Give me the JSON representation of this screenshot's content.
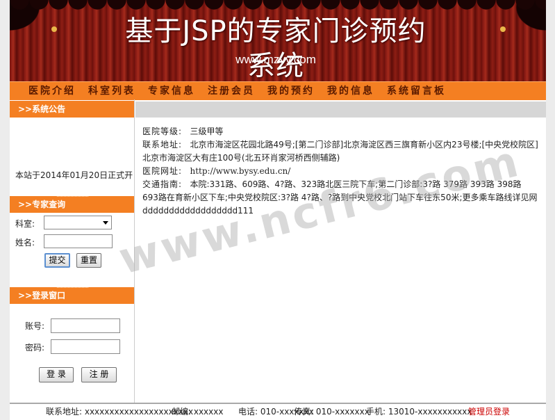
{
  "header": {
    "title": "基于JSP的专家门诊预约系统",
    "url": "www.mzyy.com"
  },
  "nav": [
    {
      "label": "医院介绍"
    },
    {
      "label": "科室列表"
    },
    {
      "label": "专家信息"
    },
    {
      "label": "注册会员"
    },
    {
      "label": "我的预约"
    },
    {
      "label": "我的信息"
    },
    {
      "label": "系统留言板"
    }
  ],
  "sidebar": {
    "notice": {
      "title": ">>系统公告",
      "text": "本站于2014年01月20日正式开"
    },
    "search": {
      "title": ">>专家查询",
      "dept_label": "科室:",
      "dept_value": "",
      "name_label": "姓名:",
      "name_value": "",
      "submit": "提交",
      "reset": "重置"
    },
    "login": {
      "title": ">>登录窗口",
      "account_label": "账号:",
      "account_value": "",
      "password_label": "密码:",
      "password_value": "",
      "login_button": "登 录",
      "register_button": "注 册"
    }
  },
  "content": {
    "level_label": "医院等级:",
    "level_value": "三级甲等",
    "address_label": "联系地址:",
    "address_value": "北京市海淀区花园北路49号;[第二门诊部]北京海淀区西三旗育新小区内23号楼;[中央党校院区]北京市海淀区大有庄100号(北五环肖家河桥西侧辅路)",
    "website_label": "医院网址:",
    "website_value": "http://www.bysy.edu.cn/",
    "traffic_label": "交通指南:",
    "traffic_value": "本院:331路、609路、4?路、323路北医三院下车;第二门诊部:3?路 379路 393路 398路 693路在育新小区下车;中央党校院区:3?路 4?路、?路到中央党校北门站下车往东50米;更多乘车路线详见网dddddddddddddddddd111"
  },
  "watermark": "www.ncfr6.com",
  "footer": {
    "address": "联系地址: xxxxxxxxxxxxxxxxxxxxxx",
    "postcode": "邮编: xxxxxx",
    "phone": "电话: 010-xxxxxxx",
    "fax": "传真: 010-xxxxxxx",
    "mobile": "手机: 13010-xxxxxxxxxxx",
    "admin_link": "管理员登录"
  },
  "colors": {
    "accent": "#f47f22",
    "banner": "#7a1410",
    "admin_link": "#cc0000"
  }
}
